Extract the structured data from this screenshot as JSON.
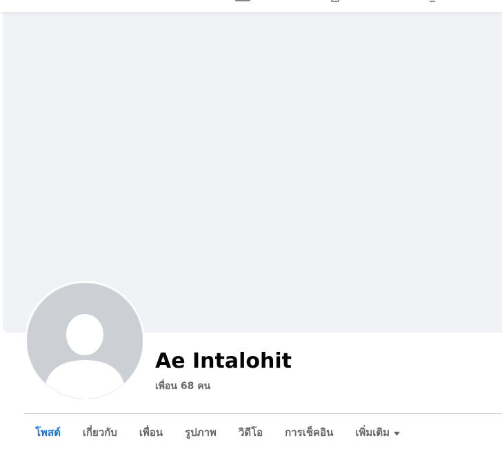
{
  "header": {
    "icons": [
      "marketplace-icon",
      "groups-icon",
      "gaming-icon"
    ]
  },
  "profile": {
    "name": "Ae Intalohit",
    "friends_label": "เพื่อน 68 คน"
  },
  "tabs": [
    {
      "label": "โพสต์",
      "active": true
    },
    {
      "label": "เกี่ยวกับ",
      "active": false
    },
    {
      "label": "เพื่อน",
      "active": false
    },
    {
      "label": "รูปภาพ",
      "active": false
    },
    {
      "label": "วิดีโอ",
      "active": false
    },
    {
      "label": "การเช็คอิน",
      "active": false
    },
    {
      "label": "เพิ่มเติม",
      "active": false,
      "dropdown": true
    }
  ],
  "colors": {
    "accent": "#1b74e4",
    "text_primary": "#050505",
    "text_secondary": "#65676b",
    "cover_bg": "#f0f2f5",
    "avatar_bg": "#ccd0d5"
  }
}
